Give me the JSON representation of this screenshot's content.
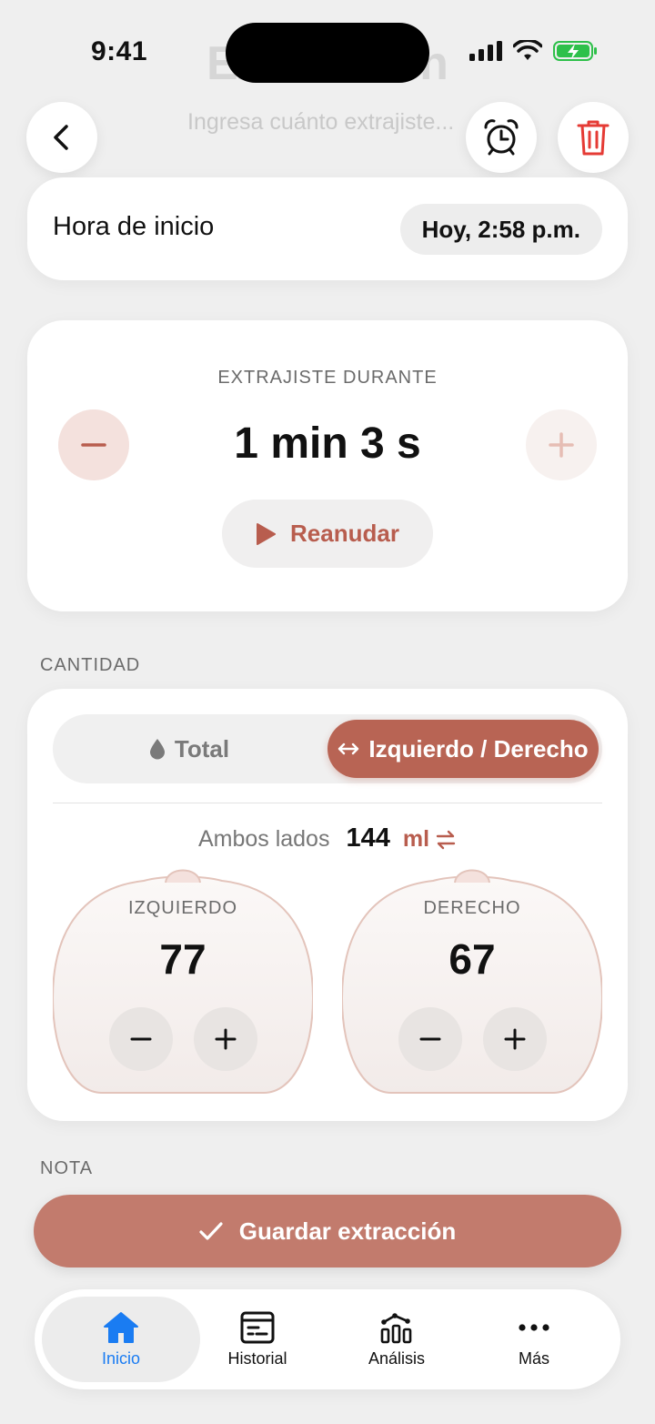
{
  "status": {
    "time": "9:41"
  },
  "header": {
    "title": "Extracción",
    "subtitle": "Ingresa cuánto extrajiste..."
  },
  "icons": {
    "back": "chevron-left-icon",
    "alarm": "alarm-clock-icon",
    "delete": "trash-icon"
  },
  "start": {
    "label": "Hora de inicio",
    "value": "Hoy, 2:58 p.m."
  },
  "duration": {
    "label": "EXTRAJISTE DURANTE",
    "value": "1 min 3 s",
    "resume_label": "Reanudar"
  },
  "quantity": {
    "section_label": "CANTIDAD",
    "modes": {
      "total": "Total",
      "split": "Izquierdo / Derecho",
      "selected": "split"
    },
    "both_label": "Ambos lados",
    "both_value": "144",
    "unit": "ml",
    "left": {
      "label": "IZQUIERDO",
      "value": "77"
    },
    "right": {
      "label": "DERECHO",
      "value": "67"
    }
  },
  "note": {
    "section_label": "NOTA"
  },
  "save_label": "Guardar extracción",
  "tabs": [
    {
      "label": "Inicio",
      "icon": "home-icon",
      "active": true
    },
    {
      "label": "Historial",
      "icon": "history-icon",
      "active": false
    },
    {
      "label": "Análisis",
      "icon": "analytics-icon",
      "active": false
    },
    {
      "label": "Más",
      "icon": "more-icon",
      "active": false
    }
  ],
  "colors": {
    "accent": "#b86454",
    "save": "#c27b6d",
    "tab_active": "#1a7cf2",
    "delete": "#e53b35"
  }
}
